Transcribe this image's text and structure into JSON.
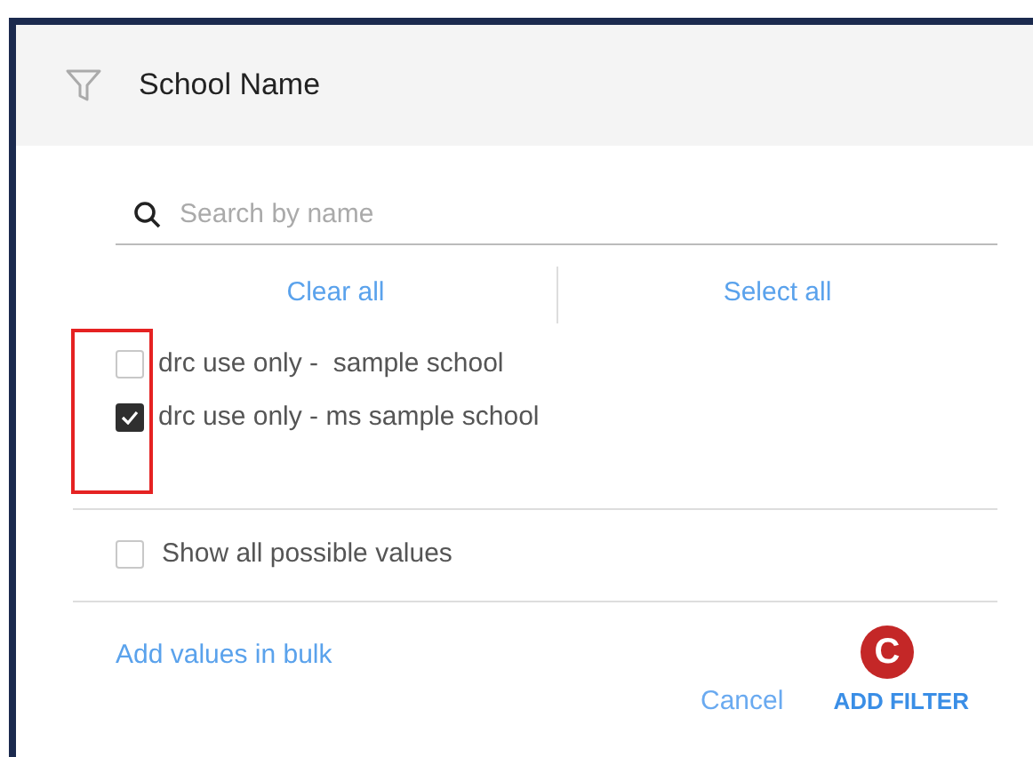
{
  "header": {
    "title": "School Name"
  },
  "search": {
    "placeholder": "Search by name"
  },
  "bulk_actions": [
    "Clear all",
    "Select all"
  ],
  "options": [
    {
      "label": "drc use only -  sample school",
      "checked": false
    },
    {
      "label": "drc use only - ms sample school",
      "checked": true
    }
  ],
  "show_all": {
    "label": "Show all possible values",
    "checked": false
  },
  "bulk_link": "Add values in bulk",
  "callout": "C",
  "buttons": {
    "cancel": "Cancel",
    "add": "ADD FILTER"
  }
}
